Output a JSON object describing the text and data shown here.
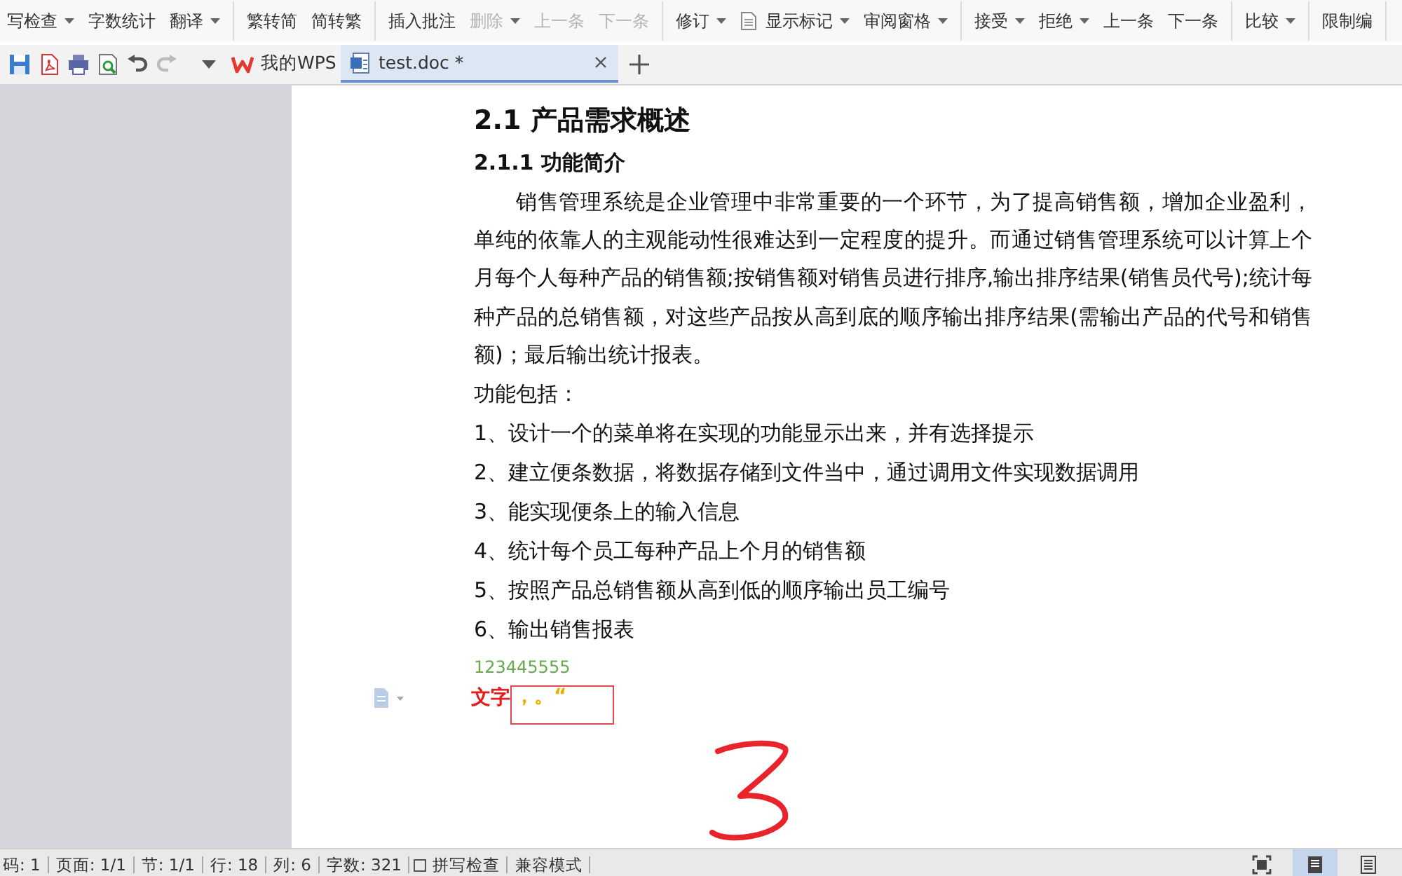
{
  "ribbon": {
    "groups": [
      {
        "items": [
          {
            "label": "写检查",
            "dropdown": true,
            "disabled": false,
            "kind": "text"
          },
          {
            "label": "字数统计",
            "dropdown": false,
            "disabled": false,
            "kind": "text"
          },
          {
            "label": "翻译",
            "dropdown": true,
            "disabled": false,
            "kind": "text"
          }
        ]
      },
      {
        "items": [
          {
            "label": "繁转简",
            "dropdown": false,
            "disabled": false,
            "kind": "text"
          },
          {
            "label": "简转繁",
            "dropdown": false,
            "disabled": false,
            "kind": "text"
          }
        ]
      },
      {
        "items": [
          {
            "label": "插入批注",
            "dropdown": false,
            "disabled": false,
            "kind": "text"
          },
          {
            "label": "删除",
            "dropdown": true,
            "disabled": true,
            "kind": "text"
          },
          {
            "label": "上一条",
            "dropdown": false,
            "disabled": true,
            "kind": "text"
          },
          {
            "label": "下一条",
            "dropdown": false,
            "disabled": true,
            "kind": "text"
          }
        ]
      },
      {
        "items": [
          {
            "label": "修订",
            "dropdown": true,
            "disabled": false,
            "kind": "text"
          },
          {
            "label": "显示标记",
            "dropdown": true,
            "disabled": false,
            "kind": "icon"
          },
          {
            "label": "审阅窗格",
            "dropdown": true,
            "disabled": false,
            "kind": "text"
          }
        ]
      },
      {
        "items": [
          {
            "label": "接受",
            "dropdown": true,
            "disabled": false,
            "kind": "text"
          },
          {
            "label": "拒绝",
            "dropdown": true,
            "disabled": false,
            "kind": "text"
          },
          {
            "label": "上一条",
            "dropdown": false,
            "disabled": false,
            "kind": "text"
          },
          {
            "label": "下一条",
            "dropdown": false,
            "disabled": false,
            "kind": "text"
          }
        ]
      },
      {
        "items": [
          {
            "label": "比较",
            "dropdown": true,
            "disabled": false,
            "kind": "text"
          }
        ]
      },
      {
        "items": [
          {
            "label": "限制编",
            "dropdown": false,
            "disabled": false,
            "kind": "text"
          }
        ]
      }
    ]
  },
  "tabs": [
    {
      "label": "我的WPS",
      "selected": false,
      "kind": "home"
    },
    {
      "label": "test.doc *",
      "selected": true,
      "kind": "doc"
    }
  ],
  "document": {
    "blocks": [
      {
        "kind": "h2",
        "text": "2.1  产品需求概述"
      },
      {
        "kind": "h3",
        "text": "2.1.1  功能简介"
      },
      {
        "kind": "para",
        "text": "销售管理系统是企业管理中非常重要的一个环节，为了提高销售额，增加企业盈利，单纯的依靠人的主观能动性很难达到一定程度的提升。而通过销售管理系统可以计算上个月每个人每种产品的销售额;按销售额对销售员进行排序,输出排序结果(销售员代号);统计每种产品的总销售额，对这些产品按从高到底的顺序输出排序结果(需输出产品的代号和销售额)；最后输出统计报表。"
      },
      {
        "kind": "line",
        "text": "功能包括："
      },
      {
        "kind": "line",
        "text": "1、设计一个的菜单将在实现的功能显示出来，并有选择提示"
      },
      {
        "kind": "line",
        "text": "2、建立便条数据，将数据存储到文件当中，通过调用文件实现数据调用"
      },
      {
        "kind": "line",
        "text": "3、能实现便条上的输入信息"
      },
      {
        "kind": "line",
        "text": "4、统计每个员工每种产品上个月的销售额"
      },
      {
        "kind": "line",
        "text": "5、按照产品总销售额从高到低的顺序输出员工编号"
      },
      {
        "kind": "line",
        "text": "6、输出销售报表"
      },
      {
        "kind": "green",
        "text": "123445555"
      },
      {
        "kind": "input",
        "text": "文字",
        "boxed": "，。“"
      }
    ]
  },
  "status_bar": {
    "items": [
      {
        "label": "码: 1",
        "kind": "text"
      },
      {
        "label": "页面: 1/1",
        "kind": "text"
      },
      {
        "label": "节: 1/1",
        "kind": "text"
      },
      {
        "label": "行: 18",
        "kind": "text"
      },
      {
        "label": "列: 6",
        "kind": "text"
      },
      {
        "label": "字数: 321",
        "kind": "text"
      },
      {
        "label": "拼写检查",
        "kind": "check",
        "checked": false
      },
      {
        "label": "兼容模式",
        "kind": "text"
      }
    ],
    "views": [
      {
        "selected": false,
        "kind": "full"
      },
      {
        "selected": true,
        "kind": "page"
      },
      {
        "selected": false,
        "kind": "outline"
      }
    ]
  }
}
